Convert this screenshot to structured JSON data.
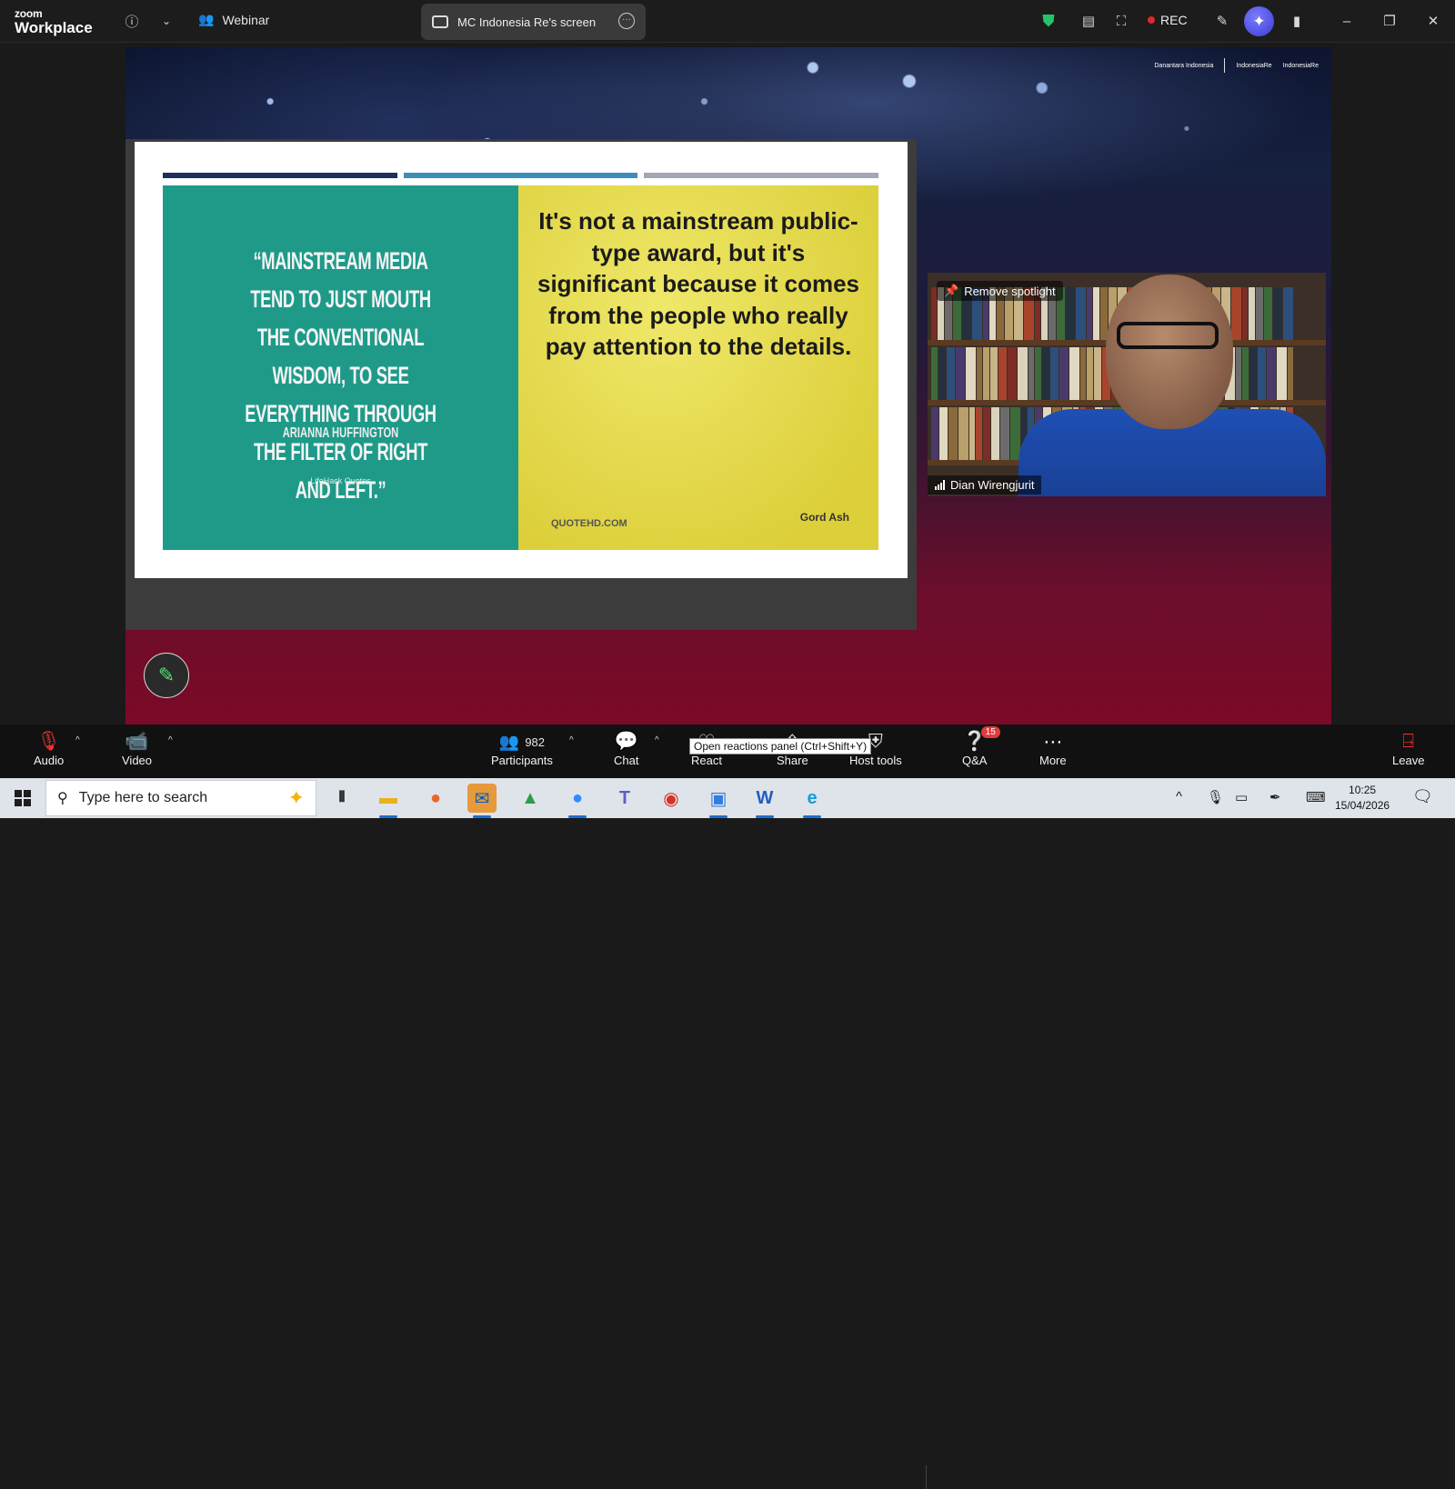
{
  "titlebar": {
    "brand_top": "zoom",
    "brand_bottom": "Workplace",
    "webinar_label": "Webinar",
    "screen_tab_label": "MC Indonesia Re's screen",
    "rec_label": "REC"
  },
  "sponsors": {
    "logo1": "Danantara Indonesia",
    "logo2": "IndonesiaRe",
    "logo3": "IndonesiaRe"
  },
  "slide": {
    "bar_colors": [
      "#1d2f5c",
      "#3d8dbb",
      "#a3a7b2"
    ],
    "left_quote": "“Mainstream media tend to just mouth the conventional wisdom, to see everything through the filter of right and left.”",
    "left_author": "ARIANNA HUFFINGTON",
    "left_source": "LifeHack Quotes",
    "right_quote": "It's not a mainstream public-type award, but it's significant because it comes from the people who really pay attention to the details.",
    "right_site": "QUOTEHD.COM",
    "right_author": "Gord Ash"
  },
  "video": {
    "remove_spotlight": "Remove spotlight",
    "participant_name": "Dian Wirengjurit"
  },
  "toolbar": {
    "audio": "Audio",
    "video": "Video",
    "participants": "Participants",
    "participant_count": "982",
    "chat": "Chat",
    "react": "React",
    "share": "Share",
    "host_tools": "Host tools",
    "qa": "Q&A",
    "qa_badge": "15",
    "more": "More",
    "leave": "Leave",
    "tooltip": "Open reactions panel (Ctrl+Shift+Y)"
  },
  "taskbar": {
    "search_placeholder": "Type here to search",
    "time": "10:25",
    "date": "15/04/2026"
  },
  "colors": {
    "accent_green": "#57e07a",
    "rec_red": "#e02828",
    "badge_red": "#e23b3b",
    "teal": "#1f9a89",
    "yellow": "#e6de4f"
  }
}
